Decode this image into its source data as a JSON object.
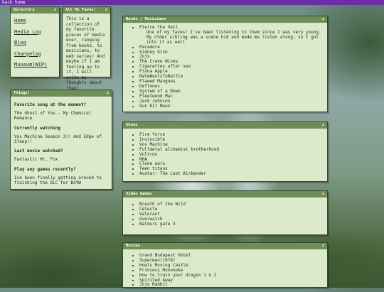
{
  "topbar": {
    "link": "back home"
  },
  "directory": {
    "title": "Directory",
    "close": "x",
    "links": [
      "Home",
      "Media Log",
      "Blog",
      "Changelog",
      "Museum(WIP)"
    ]
  },
  "faves": {
    "title": "All My Faves!",
    "close": "x",
    "text": "This is a collection of my favorite pieces of media ever, ranging from books, to musicians, to web series! And maybe if I am feeling up to it, I will write my thoughts about them!"
  },
  "things": {
    "title": "Things!",
    "close": "x",
    "qa": [
      {
        "q": "Favorite song at the moment?",
        "a": "The Ghost of You - My Chemical Romance"
      },
      {
        "q": "Currently watching",
        "a": "Vox Machina Season 3!! And Edge of Sleep!!"
      },
      {
        "q": "Last movie watched?",
        "a": "Fantastic Mr. Fox"
      },
      {
        "q": "Play any games recently?",
        "a": "Ive been finally getting around to finishing the DLC for BotW"
      }
    ]
  },
  "bands": {
    "title": "Bands / Musicians",
    "close": "x",
    "first": "Pierce the Veil",
    "note": "One of my faves! I've been listening to them since I was very young. My older sibling was a scene kid and made me listen along, so I got into it as well",
    "items": [
      "Paramore",
      "Sidney Gish",
      "Jojs",
      "The Crane Wives",
      "Cigarettes after sex",
      "Fiona Apple",
      "NateWantsToBattle",
      "Flawed Mangoes",
      "Deftones",
      "System of a Down",
      "Fleetwood Mac",
      "Jack Johnson",
      "Sun Kil Moon"
    ]
  },
  "shows": {
    "title": "Shows",
    "close": "x",
    "items": [
      "Fire force",
      "Invincible",
      "Vox Machina",
      "Fullmetal alchemist brotherhood",
      "Voltron",
      "MHA",
      "Clone wars",
      "Teen titans",
      "Avatar: The Last Airbender"
    ]
  },
  "games": {
    "title": "Video Games",
    "close": "x",
    "items": [
      "Breath of the Wild",
      "Celeste",
      "Valorant",
      "Overwatch",
      "Baldurs gate 3"
    ]
  },
  "movies": {
    "title": "Movies",
    "close": "x",
    "items": [
      "Grand Budapest Hotel",
      "Superman(1978)",
      "Howls Moving Castle",
      "Princess Mononoke",
      "How to train your dragon 1 & 2",
      "Spirited Away",
      "Jojo Rabbit"
    ]
  },
  "colors": {
    "accent": "#6a2fa6",
    "panel_header": "#6f8e57",
    "panel_bg": "#dde9cb"
  }
}
